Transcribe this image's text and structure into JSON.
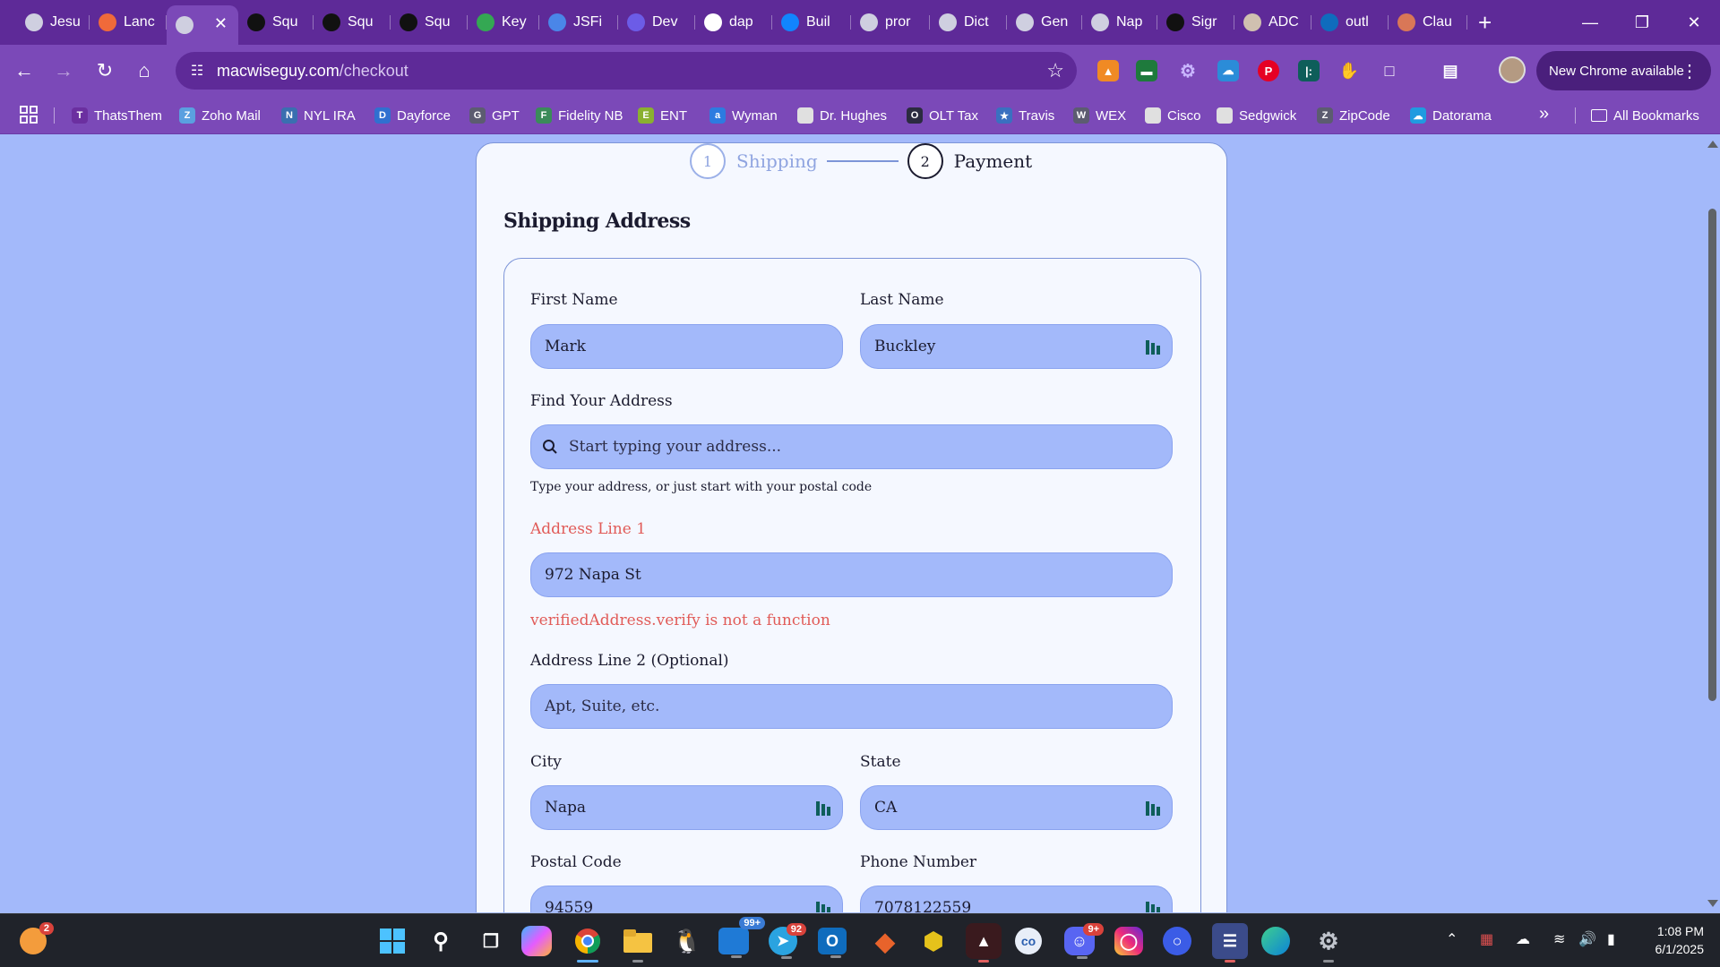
{
  "browser": {
    "tabs": [
      {
        "label": "Jesu",
        "icon": "globe-icon",
        "color": "#cfcfe0"
      },
      {
        "label": "Lanc",
        "icon": "lanc-icon",
        "color": "#f06a3a"
      },
      {
        "label": "",
        "icon": "globe-icon",
        "color": "#cfcfe0",
        "active": true
      },
      {
        "label": "Squ",
        "icon": "square-icon",
        "color": "#111111"
      },
      {
        "label": "Squ",
        "icon": "square-icon",
        "color": "#111111"
      },
      {
        "label": "Squ",
        "icon": "square-icon",
        "color": "#111111"
      },
      {
        "label": "Key",
        "icon": "map-pin-icon",
        "color": "#34a853"
      },
      {
        "label": "JSFi",
        "icon": "cloud-icon",
        "color": "#4a86e8"
      },
      {
        "label": "Dev",
        "icon": "s-icon",
        "color": "#6c5ce7"
      },
      {
        "label": "dap",
        "icon": "github-icon",
        "color": "#ffffff"
      },
      {
        "label": "Buil",
        "icon": "butterfly-icon",
        "color": "#1185fe"
      },
      {
        "label": "pror",
        "icon": "globe-icon",
        "color": "#cfcfe0"
      },
      {
        "label": "Dict",
        "icon": "openai-icon",
        "color": "#cfcfe0"
      },
      {
        "label": "Gen",
        "icon": "openai-icon",
        "color": "#cfcfe0"
      },
      {
        "label": "Nap",
        "icon": "openai-icon",
        "color": "#cfcfe0"
      },
      {
        "label": "Sigr",
        "icon": "square-icon",
        "color": "#111111"
      },
      {
        "label": "ADC",
        "icon": "avatar-icon",
        "color": "#d0c0b0"
      },
      {
        "label": "outl",
        "icon": "outlook-icon",
        "color": "#0f6cbd"
      },
      {
        "label": "Clau",
        "icon": "claude-icon",
        "color": "#d97757"
      }
    ],
    "close_tab": "✕",
    "new_tab": "+",
    "url_domain": "macwiseguy.com",
    "url_path": "/checkout",
    "new_chrome_label": "New Chrome available",
    "bookmarks": [
      {
        "label": "ThatsThem",
        "color": "#6b2fa0",
        "glyph": "T"
      },
      {
        "label": "Zoho Mail",
        "color": "#5aa0e0",
        "glyph": "Z"
      },
      {
        "label": "NYL IRA",
        "color": "#3a6fb0",
        "glyph": "N"
      },
      {
        "label": "Dayforce",
        "color": "#3070d0",
        "glyph": "D"
      },
      {
        "label": "GPT",
        "color": "#5c5c70",
        "glyph": "G"
      },
      {
        "label": "Fidelity NB",
        "color": "#3b8b5a",
        "glyph": "F"
      },
      {
        "label": "ENT",
        "color": "#8ab030",
        "glyph": "E"
      },
      {
        "label": "Wyman",
        "color": "#2d7be0",
        "glyph": "a"
      },
      {
        "label": "Dr. Hughes",
        "color": "#e0e0e0",
        "glyph": ""
      },
      {
        "label": "OLT Tax",
        "color": "#2b2b40",
        "glyph": "O"
      },
      {
        "label": "Travis",
        "color": "#3a70c0",
        "glyph": "★"
      },
      {
        "label": "WEX",
        "color": "#5c5c70",
        "glyph": "W"
      },
      {
        "label": "Cisco",
        "color": "#e0e0e0",
        "glyph": ""
      },
      {
        "label": "Sedgwick",
        "color": "#e0e0e0",
        "glyph": ""
      },
      {
        "label": "ZipCode",
        "color": "#5c5c70",
        "glyph": "Z"
      },
      {
        "label": "Datorama",
        "color": "#1f9be0",
        "glyph": "☁"
      }
    ],
    "bookmarks_more": "»",
    "all_bookmarks": "All Bookmarks"
  },
  "checkout": {
    "steps": [
      {
        "number": "1",
        "label": "Shipping"
      },
      {
        "number": "2",
        "label": "Payment"
      }
    ],
    "section_title": "Shipping Address",
    "fields": {
      "first_name": {
        "label": "First Name",
        "value": "Mark"
      },
      "last_name": {
        "label": "Last Name",
        "value": "Buckley"
      },
      "find_address": {
        "label": "Find Your Address",
        "placeholder": "Start typing your address...",
        "hint": "Type your address, or just start with your postal code"
      },
      "address_line1": {
        "label": "Address Line 1",
        "value": "972 Napa St",
        "error": "verifiedAddress.verify is not a function"
      },
      "address_line2": {
        "label": "Address Line 2 (Optional)",
        "placeholder": "Apt, Suite, etc."
      },
      "city": {
        "label": "City",
        "value": "Napa"
      },
      "state": {
        "label": "State",
        "value": "CA"
      },
      "postal_code": {
        "label": "Postal Code",
        "value": "94559"
      },
      "phone": {
        "label": "Phone Number",
        "value": "7078122559"
      }
    },
    "colors": {
      "page_bg": "#a3b9fa",
      "card_bg": "#f5f8ff",
      "error": "#e15b58",
      "text": "#1b1b2f"
    }
  },
  "taskbar": {
    "notification_count": "2",
    "telegram_badge": "99+",
    "messenger_badge": "92",
    "discord_badge": "9+",
    "time": "1:08 PM",
    "date": "6/1/2025"
  }
}
